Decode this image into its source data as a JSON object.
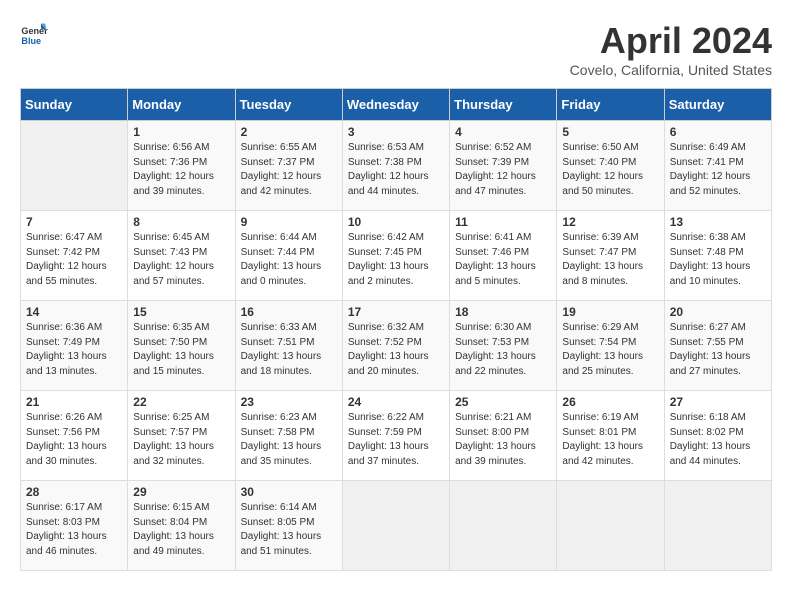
{
  "logo": {
    "text_general": "General",
    "text_blue": "Blue"
  },
  "title": "April 2024",
  "location": "Covelo, California, United States",
  "days_of_week": [
    "Sunday",
    "Monday",
    "Tuesday",
    "Wednesday",
    "Thursday",
    "Friday",
    "Saturday"
  ],
  "weeks": [
    [
      {
        "day": "",
        "empty": true
      },
      {
        "day": "1",
        "sunrise": "Sunrise: 6:56 AM",
        "sunset": "Sunset: 7:36 PM",
        "daylight": "Daylight: 12 hours and 39 minutes."
      },
      {
        "day": "2",
        "sunrise": "Sunrise: 6:55 AM",
        "sunset": "Sunset: 7:37 PM",
        "daylight": "Daylight: 12 hours and 42 minutes."
      },
      {
        "day": "3",
        "sunrise": "Sunrise: 6:53 AM",
        "sunset": "Sunset: 7:38 PM",
        "daylight": "Daylight: 12 hours and 44 minutes."
      },
      {
        "day": "4",
        "sunrise": "Sunrise: 6:52 AM",
        "sunset": "Sunset: 7:39 PM",
        "daylight": "Daylight: 12 hours and 47 minutes."
      },
      {
        "day": "5",
        "sunrise": "Sunrise: 6:50 AM",
        "sunset": "Sunset: 7:40 PM",
        "daylight": "Daylight: 12 hours and 50 minutes."
      },
      {
        "day": "6",
        "sunrise": "Sunrise: 6:49 AM",
        "sunset": "Sunset: 7:41 PM",
        "daylight": "Daylight: 12 hours and 52 minutes."
      }
    ],
    [
      {
        "day": "7",
        "sunrise": "Sunrise: 6:47 AM",
        "sunset": "Sunset: 7:42 PM",
        "daylight": "Daylight: 12 hours and 55 minutes."
      },
      {
        "day": "8",
        "sunrise": "Sunrise: 6:45 AM",
        "sunset": "Sunset: 7:43 PM",
        "daylight": "Daylight: 12 hours and 57 minutes."
      },
      {
        "day": "9",
        "sunrise": "Sunrise: 6:44 AM",
        "sunset": "Sunset: 7:44 PM",
        "daylight": "Daylight: 13 hours and 0 minutes."
      },
      {
        "day": "10",
        "sunrise": "Sunrise: 6:42 AM",
        "sunset": "Sunset: 7:45 PM",
        "daylight": "Daylight: 13 hours and 2 minutes."
      },
      {
        "day": "11",
        "sunrise": "Sunrise: 6:41 AM",
        "sunset": "Sunset: 7:46 PM",
        "daylight": "Daylight: 13 hours and 5 minutes."
      },
      {
        "day": "12",
        "sunrise": "Sunrise: 6:39 AM",
        "sunset": "Sunset: 7:47 PM",
        "daylight": "Daylight: 13 hours and 8 minutes."
      },
      {
        "day": "13",
        "sunrise": "Sunrise: 6:38 AM",
        "sunset": "Sunset: 7:48 PM",
        "daylight": "Daylight: 13 hours and 10 minutes."
      }
    ],
    [
      {
        "day": "14",
        "sunrise": "Sunrise: 6:36 AM",
        "sunset": "Sunset: 7:49 PM",
        "daylight": "Daylight: 13 hours and 13 minutes."
      },
      {
        "day": "15",
        "sunrise": "Sunrise: 6:35 AM",
        "sunset": "Sunset: 7:50 PM",
        "daylight": "Daylight: 13 hours and 15 minutes."
      },
      {
        "day": "16",
        "sunrise": "Sunrise: 6:33 AM",
        "sunset": "Sunset: 7:51 PM",
        "daylight": "Daylight: 13 hours and 18 minutes."
      },
      {
        "day": "17",
        "sunrise": "Sunrise: 6:32 AM",
        "sunset": "Sunset: 7:52 PM",
        "daylight": "Daylight: 13 hours and 20 minutes."
      },
      {
        "day": "18",
        "sunrise": "Sunrise: 6:30 AM",
        "sunset": "Sunset: 7:53 PM",
        "daylight": "Daylight: 13 hours and 22 minutes."
      },
      {
        "day": "19",
        "sunrise": "Sunrise: 6:29 AM",
        "sunset": "Sunset: 7:54 PM",
        "daylight": "Daylight: 13 hours and 25 minutes."
      },
      {
        "day": "20",
        "sunrise": "Sunrise: 6:27 AM",
        "sunset": "Sunset: 7:55 PM",
        "daylight": "Daylight: 13 hours and 27 minutes."
      }
    ],
    [
      {
        "day": "21",
        "sunrise": "Sunrise: 6:26 AM",
        "sunset": "Sunset: 7:56 PM",
        "daylight": "Daylight: 13 hours and 30 minutes."
      },
      {
        "day": "22",
        "sunrise": "Sunrise: 6:25 AM",
        "sunset": "Sunset: 7:57 PM",
        "daylight": "Daylight: 13 hours and 32 minutes."
      },
      {
        "day": "23",
        "sunrise": "Sunrise: 6:23 AM",
        "sunset": "Sunset: 7:58 PM",
        "daylight": "Daylight: 13 hours and 35 minutes."
      },
      {
        "day": "24",
        "sunrise": "Sunrise: 6:22 AM",
        "sunset": "Sunset: 7:59 PM",
        "daylight": "Daylight: 13 hours and 37 minutes."
      },
      {
        "day": "25",
        "sunrise": "Sunrise: 6:21 AM",
        "sunset": "Sunset: 8:00 PM",
        "daylight": "Daylight: 13 hours and 39 minutes."
      },
      {
        "day": "26",
        "sunrise": "Sunrise: 6:19 AM",
        "sunset": "Sunset: 8:01 PM",
        "daylight": "Daylight: 13 hours and 42 minutes."
      },
      {
        "day": "27",
        "sunrise": "Sunrise: 6:18 AM",
        "sunset": "Sunset: 8:02 PM",
        "daylight": "Daylight: 13 hours and 44 minutes."
      }
    ],
    [
      {
        "day": "28",
        "sunrise": "Sunrise: 6:17 AM",
        "sunset": "Sunset: 8:03 PM",
        "daylight": "Daylight: 13 hours and 46 minutes."
      },
      {
        "day": "29",
        "sunrise": "Sunrise: 6:15 AM",
        "sunset": "Sunset: 8:04 PM",
        "daylight": "Daylight: 13 hours and 49 minutes."
      },
      {
        "day": "30",
        "sunrise": "Sunrise: 6:14 AM",
        "sunset": "Sunset: 8:05 PM",
        "daylight": "Daylight: 13 hours and 51 minutes."
      },
      {
        "day": "",
        "empty": true
      },
      {
        "day": "",
        "empty": true
      },
      {
        "day": "",
        "empty": true
      },
      {
        "day": "",
        "empty": true
      }
    ]
  ]
}
